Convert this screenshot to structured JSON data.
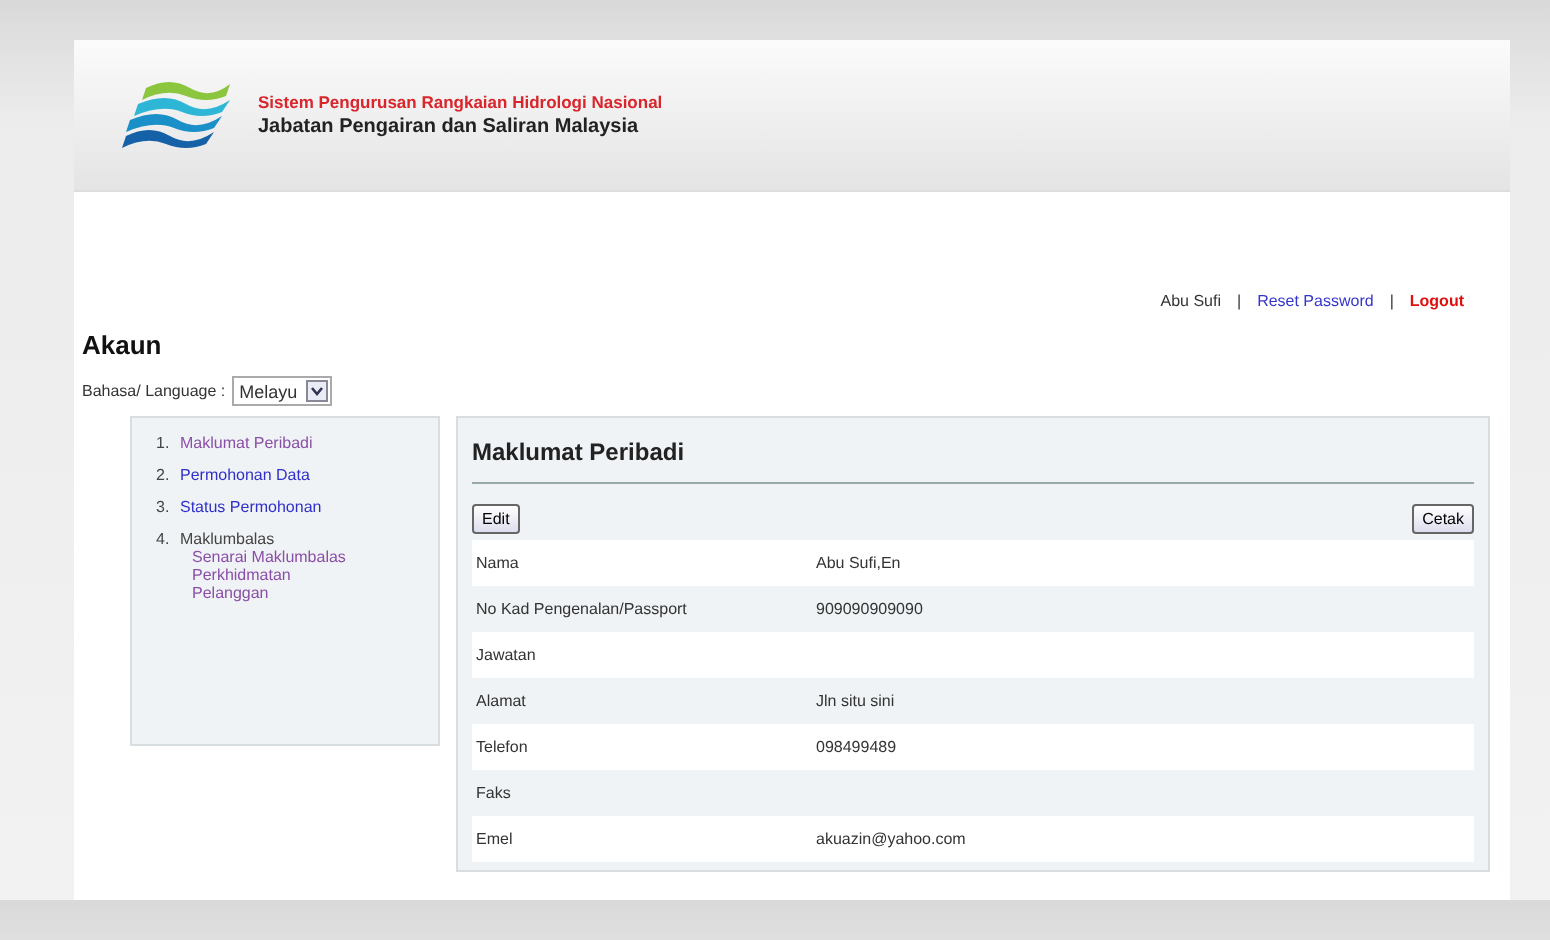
{
  "header": {
    "system_name": "Sistem Pengurusan Rangkaian Hidrologi Nasional",
    "department": "Jabatan Pengairan dan Saliran Malaysia"
  },
  "user_bar": {
    "user": "Abu Sufi",
    "separator": "|",
    "reset": "Reset Password",
    "logout": "Logout"
  },
  "page_title": "Akaun",
  "language": {
    "label": "Bahasa/ Language :",
    "value": "Melayu"
  },
  "sidebar": {
    "items": [
      {
        "number": "1.",
        "label": "Maklumat Peribadi",
        "selected": true,
        "kind": "link"
      },
      {
        "number": "2.",
        "label": "Permohonan Data",
        "selected": false,
        "kind": "link"
      },
      {
        "number": "3.",
        "label": "Status Permohonan",
        "selected": false,
        "kind": "link"
      },
      {
        "number": "4.",
        "label": "Maklumbalas",
        "selected": false,
        "kind": "heading",
        "children": [
          {
            "label": "Senarai Maklumbalas Perkhidmatan Pelanggan",
            "selected": true
          }
        ]
      }
    ]
  },
  "panel": {
    "title": "Maklumat Peribadi",
    "buttons": [
      "Edit",
      "Cetak"
    ],
    "rows": [
      {
        "label": "Nama",
        "value": "Abu Sufi,En"
      },
      {
        "label": "No Kad Pengenalan/Passport",
        "value": "909090909090"
      },
      {
        "label": "Jawatan",
        "value": ""
      },
      {
        "label": "Alamat",
        "value": "Jln situ sini"
      },
      {
        "label": "Telefon",
        "value": "098499489"
      },
      {
        "label": "Faks",
        "value": ""
      },
      {
        "label": "Emel",
        "value": "akuazin@yahoo.com"
      }
    ]
  }
}
